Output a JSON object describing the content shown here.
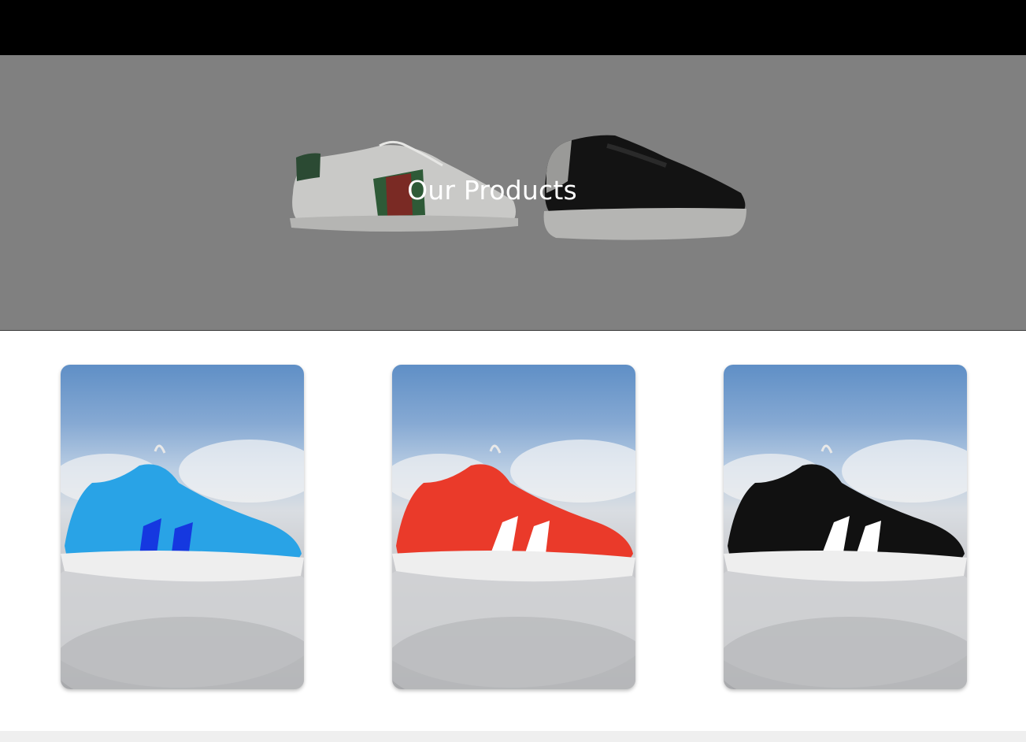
{
  "hero": {
    "title": "Our Products"
  },
  "products": [
    {
      "name": "blue-sneaker",
      "color": "#29a3e6",
      "stripe_color": "#1538e0"
    },
    {
      "name": "red-sneaker",
      "color": "#ea3a2a",
      "stripe_color": "#ffffff"
    },
    {
      "name": "black-sneaker",
      "color": "#111111",
      "stripe_color": "#ffffff"
    }
  ],
  "colors": {
    "topbar": "#000000",
    "hero_overlay": "#808080",
    "page_background": "#ffffff"
  }
}
